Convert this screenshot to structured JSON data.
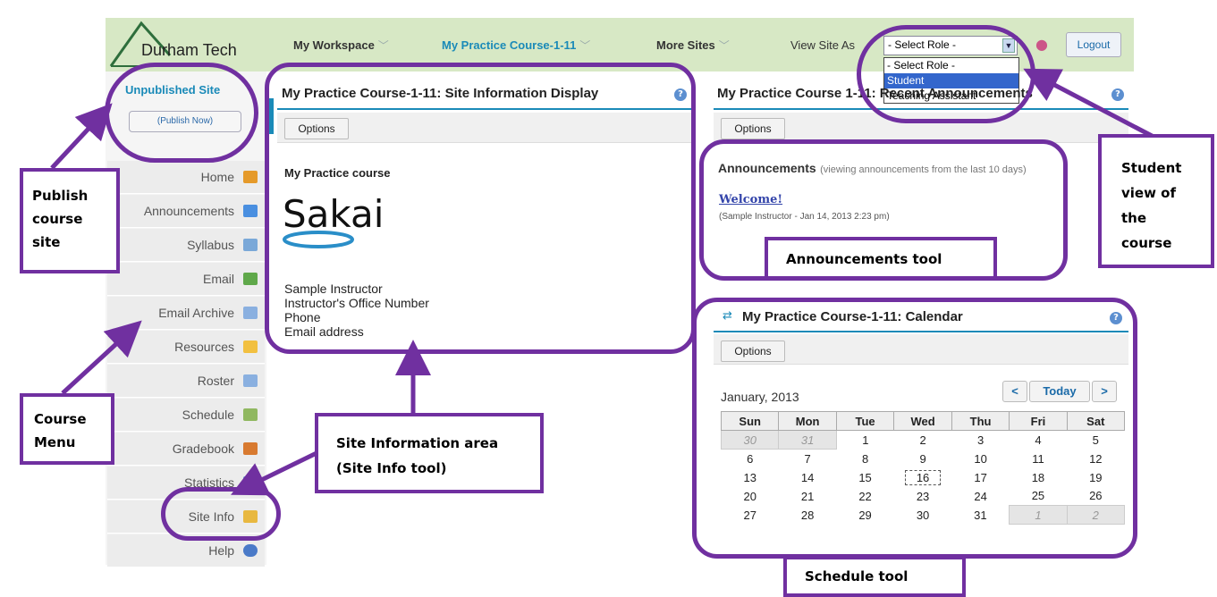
{
  "header": {
    "logo_text": "Durham Tech",
    "nav": [
      {
        "label": "My Workspace"
      },
      {
        "label": "My Practice Course-1-11"
      },
      {
        "label": "More Sites"
      }
    ],
    "view_site_as": "View Site As",
    "role_select_value": "- Select Role -",
    "role_options": [
      "- Select Role -",
      "Student",
      "Teaching Assistant"
    ],
    "role_selected": "Student",
    "logout_label": "Logout"
  },
  "sidebar": {
    "status": "Unpublished Site",
    "publish_label": "(Publish Now)",
    "items": [
      {
        "label": "Home",
        "icon": "home-icon",
        "color": "#e59a2a"
      },
      {
        "label": "Announcements",
        "icon": "megaphone-icon",
        "color": "#4a8fe0"
      },
      {
        "label": "Syllabus",
        "icon": "syllabus-icon",
        "color": "#7aa8d8"
      },
      {
        "label": "Email",
        "icon": "email-icon",
        "color": "#5fa84a"
      },
      {
        "label": "Email Archive",
        "icon": "envelope-icon",
        "color": "#8ab0e0"
      },
      {
        "label": "Resources",
        "icon": "folder-icon",
        "color": "#f2c040"
      },
      {
        "label": "Roster",
        "icon": "roster-icon",
        "color": "#8ab0e0"
      },
      {
        "label": "Schedule",
        "icon": "calendar-icon",
        "color": "#90b860"
      },
      {
        "label": "Gradebook",
        "icon": "gradebook-icon",
        "color": "#d87a30"
      },
      {
        "label": "Statistics",
        "icon": "statistics-icon",
        "color": "#6a9ad8"
      },
      {
        "label": "Site Info",
        "icon": "site-info-icon",
        "color": "#e8b840"
      },
      {
        "label": "Help",
        "icon": "help-icon",
        "color": "#4a7ac8"
      }
    ]
  },
  "site_info": {
    "title": "My Practice Course-1-11: Site Information Display",
    "options_label": "Options",
    "course_name": "My Practice course",
    "logo_text": "Sakai",
    "lines": [
      "Sample Instructor",
      "Instructor's Office Number",
      "Phone",
      "Email address"
    ]
  },
  "announcements": {
    "title": "My Practice Course 1-11: Recent Announcements",
    "options_label": "Options",
    "heading": "Announcements",
    "subheading": "(viewing announcements from the last 10 days)",
    "item_title": "Welcome!",
    "item_meta": "(Sample Instructor - Jan 14, 2013 2:23 pm)"
  },
  "calendar": {
    "title": "My Practice Course-1-11: Calendar",
    "options_label": "Options",
    "month": "January, 2013",
    "prev_label": "<",
    "today_label": "Today",
    "next_label": ">",
    "days": [
      "Sun",
      "Mon",
      "Tue",
      "Wed",
      "Thu",
      "Fri",
      "Sat"
    ],
    "weeks": [
      [
        "30",
        "31",
        "1",
        "2",
        "3",
        "4",
        "5"
      ],
      [
        "6",
        "7",
        "8",
        "9",
        "10",
        "11",
        "12"
      ],
      [
        "13",
        "14",
        "15",
        "16",
        "17",
        "18",
        "19"
      ],
      [
        "20",
        "21",
        "22",
        "23",
        "24",
        "25",
        "26"
      ],
      [
        "27",
        "28",
        "29",
        "30",
        "31",
        "1",
        "2"
      ]
    ]
  },
  "callouts": {
    "publish": "Publish course site",
    "course_menu": "Course Menu",
    "site_info_area": "Site Information area (Site Info tool)",
    "announcements_tool": "Announcements tool",
    "student_view": "Student view of the course",
    "schedule_tool": "Schedule tool"
  },
  "annotation_color": "#7030a0"
}
